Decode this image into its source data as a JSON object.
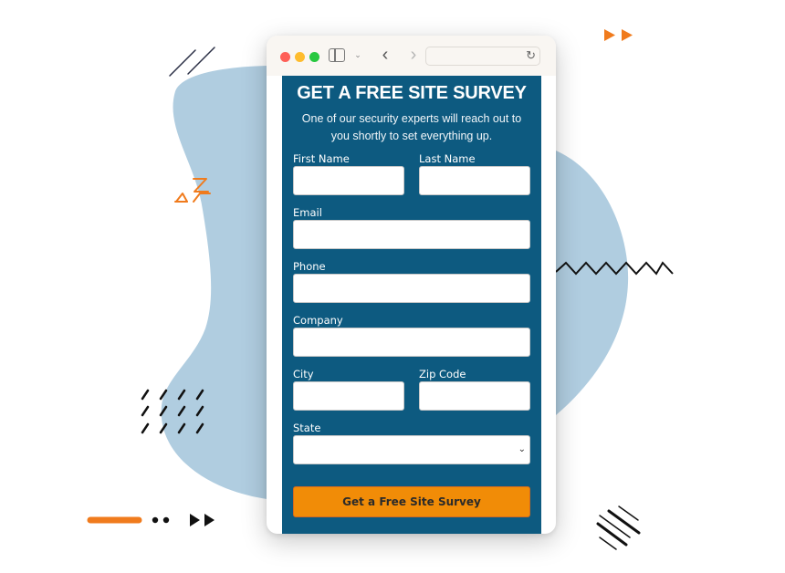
{
  "browser": {
    "window_controls": [
      "close",
      "minimize",
      "maximize"
    ],
    "icons": {
      "sidebar": "sidebar-icon",
      "chevron": "chevron-down-icon",
      "back": "back-icon",
      "forward": "forward-icon",
      "reload": "reload-icon"
    },
    "url": ""
  },
  "form": {
    "title": "GET A FREE SITE SURVEY",
    "subtitle": "One of our security experts will reach out to you shortly to set everything up.",
    "fields": {
      "first_name": {
        "label": "First Name",
        "value": ""
      },
      "last_name": {
        "label": "Last Name",
        "value": ""
      },
      "email": {
        "label": "Email",
        "value": ""
      },
      "phone": {
        "label": "Phone",
        "value": ""
      },
      "company": {
        "label": "Company",
        "value": ""
      },
      "city": {
        "label": "City",
        "value": ""
      },
      "zip": {
        "label": "Zip Code",
        "value": ""
      },
      "state": {
        "label": "State",
        "value": ""
      }
    },
    "submit_label": "Get a Free Site Survey"
  },
  "colors": {
    "form_bg": "#0d5a80",
    "button": "#f18c07",
    "blob": "#b0cde0",
    "accent_orange": "#f07b1d"
  }
}
